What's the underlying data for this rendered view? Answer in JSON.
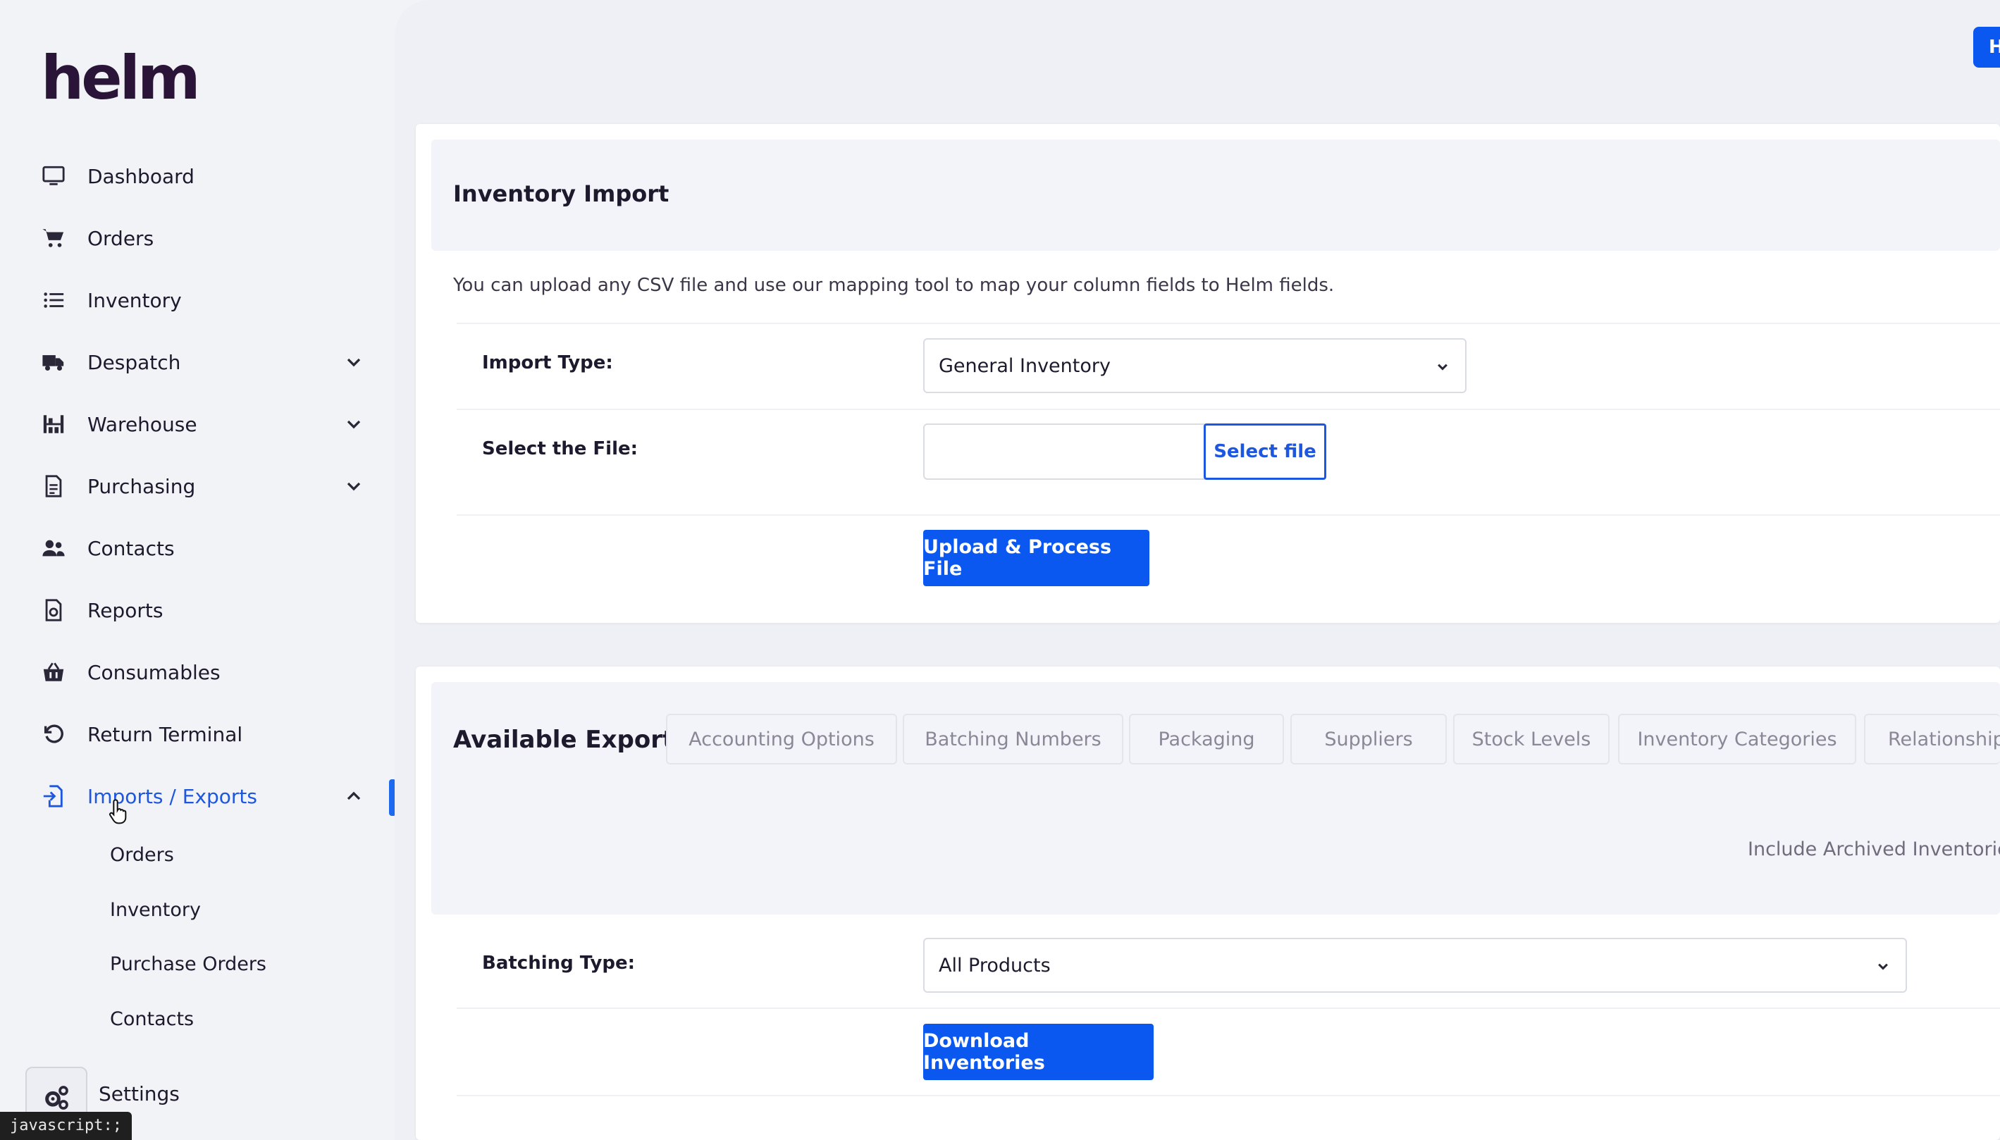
{
  "app": {
    "logo_text": "helm"
  },
  "sidebar": {
    "items": [
      {
        "label": "Dashboard",
        "icon": "monitor-icon"
      },
      {
        "label": "Orders",
        "icon": "cart-icon"
      },
      {
        "label": "Inventory",
        "icon": "list-icon"
      },
      {
        "label": "Despatch",
        "icon": "truck-icon",
        "expandable": true
      },
      {
        "label": "Warehouse",
        "icon": "warehouse-icon",
        "expandable": true
      },
      {
        "label": "Purchasing",
        "icon": "document-icon",
        "expandable": true
      },
      {
        "label": "Contacts",
        "icon": "users-icon"
      },
      {
        "label": "Reports",
        "icon": "report-icon"
      },
      {
        "label": "Consumables",
        "icon": "basket-icon"
      },
      {
        "label": "Return Terminal",
        "icon": "undo-icon"
      },
      {
        "label": "Imports / Exports",
        "icon": "import-icon",
        "expandable": true,
        "active": true
      }
    ],
    "subitems": [
      "Orders",
      "Inventory",
      "Purchase Orders",
      "Contacts"
    ],
    "settings_label": "Settings",
    "accent_color": "#1d57e0"
  },
  "statusbar": {
    "text": "javascript:;"
  },
  "header": {
    "button_label": "H"
  },
  "import_card": {
    "title": "Inventory Import",
    "description": "You can upload any CSV file and use our mapping tool to map your column fields to Helm fields.",
    "import_type_label": "Import Type:",
    "import_type_value": "General Inventory",
    "file_label": "Select the File:",
    "select_file_button": "Select file",
    "upload_button": "Upload & Process File"
  },
  "exports_card": {
    "title": "Available Exports",
    "tabs": [
      "Accounting Options",
      "Batching Numbers",
      "Packaging",
      "Suppliers",
      "Stock Levels",
      "Inventory Categories",
      "Relationships"
    ],
    "include_archived_label": "Include Archived Inventories",
    "batching_type_label": "Batching Type:",
    "batching_type_value": "All Products",
    "download_button": "Download Inventories"
  }
}
